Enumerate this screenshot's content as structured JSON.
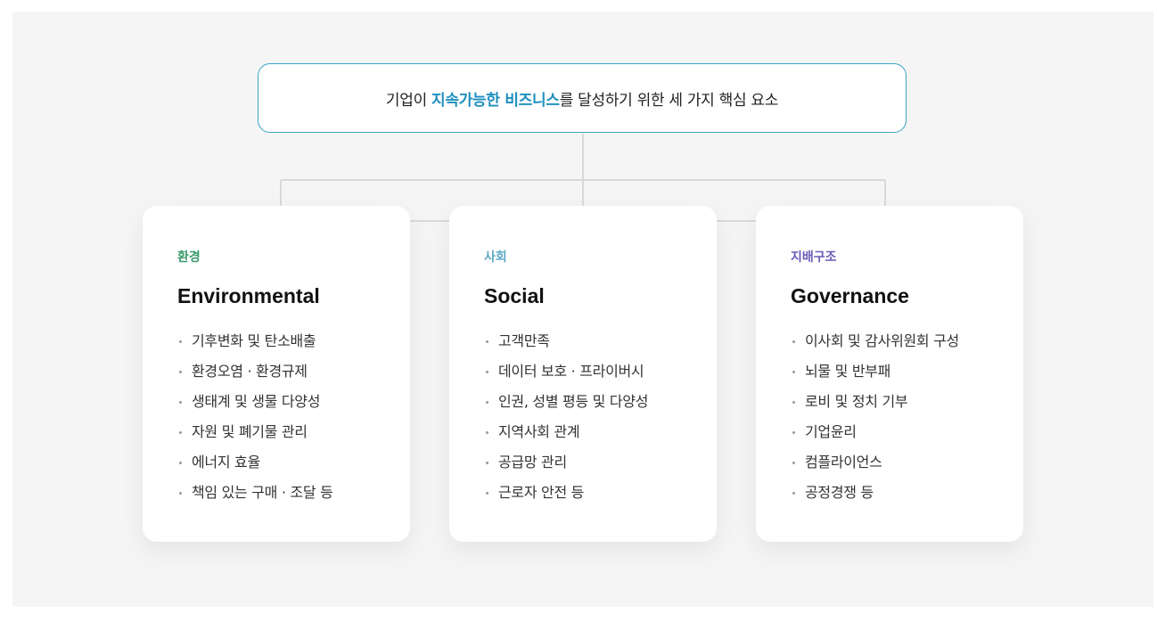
{
  "header": {
    "prefix": "기업이 ",
    "highlight": "지속가능한 비즈니스",
    "suffix": "를 달성하기 위한 세 가지 핵심 요소"
  },
  "colors": {
    "accent": "#1e8fbf",
    "environment": "#3a9a6a",
    "social": "#5aa8c4",
    "governance": "#6a5cb8"
  },
  "cards": [
    {
      "subtitle": "환경",
      "title": "Environmental",
      "items": [
        "기후변화 및 탄소배출",
        "환경오염 · 환경규제",
        "생태계 및 생물 다양성",
        "자원 및 폐기물 관리",
        "에너지 효율",
        "책임 있는 구매 · 조달 등"
      ]
    },
    {
      "subtitle": "사회",
      "title": "Social",
      "items": [
        "고객만족",
        "데이터 보호 · 프라이버시",
        "인권, 성별 평등 및 다양성",
        "지역사회 관계",
        "공급망 관리",
        "근로자 안전 등"
      ]
    },
    {
      "subtitle": "지배구조",
      "title": "Governance",
      "items": [
        "이사회 및 감사위원회 구성",
        "뇌물 및 반부패",
        "로비 및 정치 기부",
        "기업윤리",
        "컴플라이언스",
        "공정경쟁 등"
      ]
    }
  ]
}
